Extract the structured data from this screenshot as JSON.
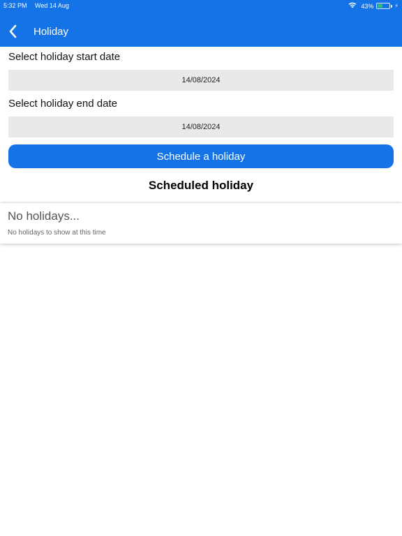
{
  "status_bar": {
    "time": "5:32 PM",
    "date": "Wed 14 Aug",
    "wifi_icon": "wifi-icon",
    "battery_percent": "43%",
    "battery_level": 0.43,
    "charging_icon": "charging-bolt-icon",
    "battery_color": "#34c759"
  },
  "header": {
    "title": "Holiday",
    "back_icon": "chevron-left-icon",
    "background": "#1473e6"
  },
  "form": {
    "start_label": "Select holiday start date",
    "start_value": "14/08/2024",
    "end_label": "Select holiday end date",
    "end_value": "14/08/2024",
    "schedule_button": "Schedule a holiday"
  },
  "scheduled": {
    "title": "Scheduled holiday",
    "empty_title": "No holidays...",
    "empty_subtitle": "No holidays to show at this time"
  }
}
